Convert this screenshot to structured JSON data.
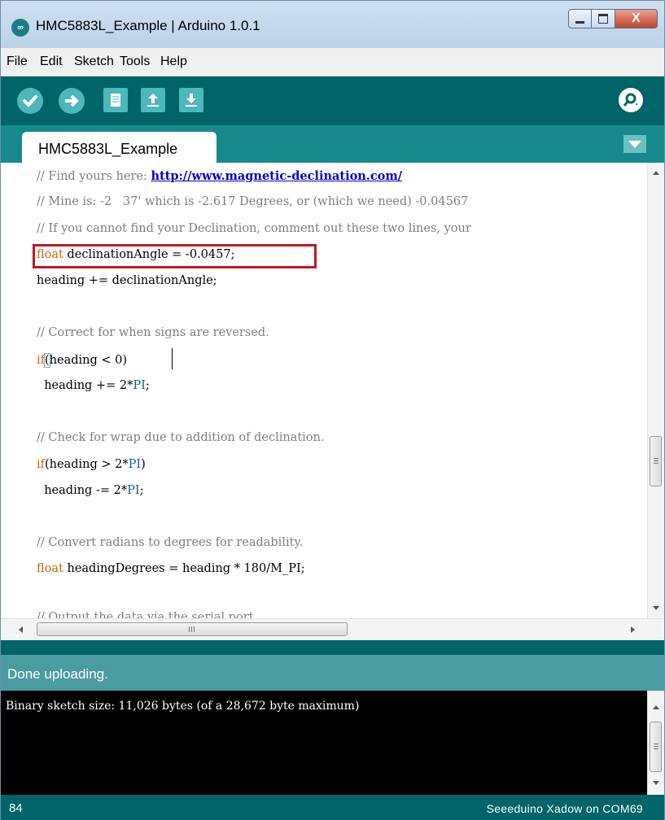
{
  "window": {
    "title": "HMC5883L_Example | Arduino 1.0.1",
    "app_icon_glyph": "∞",
    "close_glyph": "X"
  },
  "menu": [
    "File",
    "Edit",
    "Sketch",
    "Tools",
    "Help"
  ],
  "toolbar": {
    "buttons": [
      "verify-icon",
      "upload-icon",
      "new-icon",
      "open-icon",
      "save-icon"
    ],
    "serial_monitor_icon": "serial-monitor-icon",
    "accent_color": "#006468",
    "button_color": "#4db7bb"
  },
  "tab": {
    "label": "HMC5883L_Example"
  },
  "editor": {
    "line1_comment": "// Find yours here: ",
    "line1_link": "http://www.magnetic-declination.com/",
    "line2": "// Mine is: -2   37' which is -2.617 Degrees, or (which we need) -0.04567",
    "line3": "// If you cannot find your Declination, comment out these two lines, your",
    "line4_kw": "float",
    "line4_rest": " declinationAngle = -0.0457;",
    "line5": "heading += declinationAngle;",
    "line6": "// Correct for when signs are reversed.",
    "line7_kw": "if",
    "line7_paren": "(",
    "line7_rest": "heading < 0)",
    "line8_a": "  heading += 2*",
    "line8_const": "PI",
    "line8_b": ";",
    "line9": "// Check for wrap due to addition of declination.",
    "line10_kw": "if",
    "line10_a": "(heading > 2*",
    "line10_const": "PI",
    "line10_b": ")",
    "line11_a": "  heading -= 2*",
    "line11_const": "PI",
    "line11_b": ";",
    "line12": "// Convert radians to degrees for readability.",
    "line13_kw": "float",
    "line13_rest": " headingDegrees = heading * 180/M_PI;",
    "line14_partial": "// Output the data via the serial port."
  },
  "status": {
    "message": "Done uploading."
  },
  "console": {
    "line": "Binary sketch size: 11,026 bytes (of a 28,672 byte maximum)"
  },
  "footer": {
    "line_number": "84",
    "board": "Seeeduino Xadow on COM69"
  },
  "colors": {
    "keyword": "#cc6600",
    "constant": "#006699",
    "comment": "#7e7e7e",
    "highlight": "#c0161b"
  }
}
